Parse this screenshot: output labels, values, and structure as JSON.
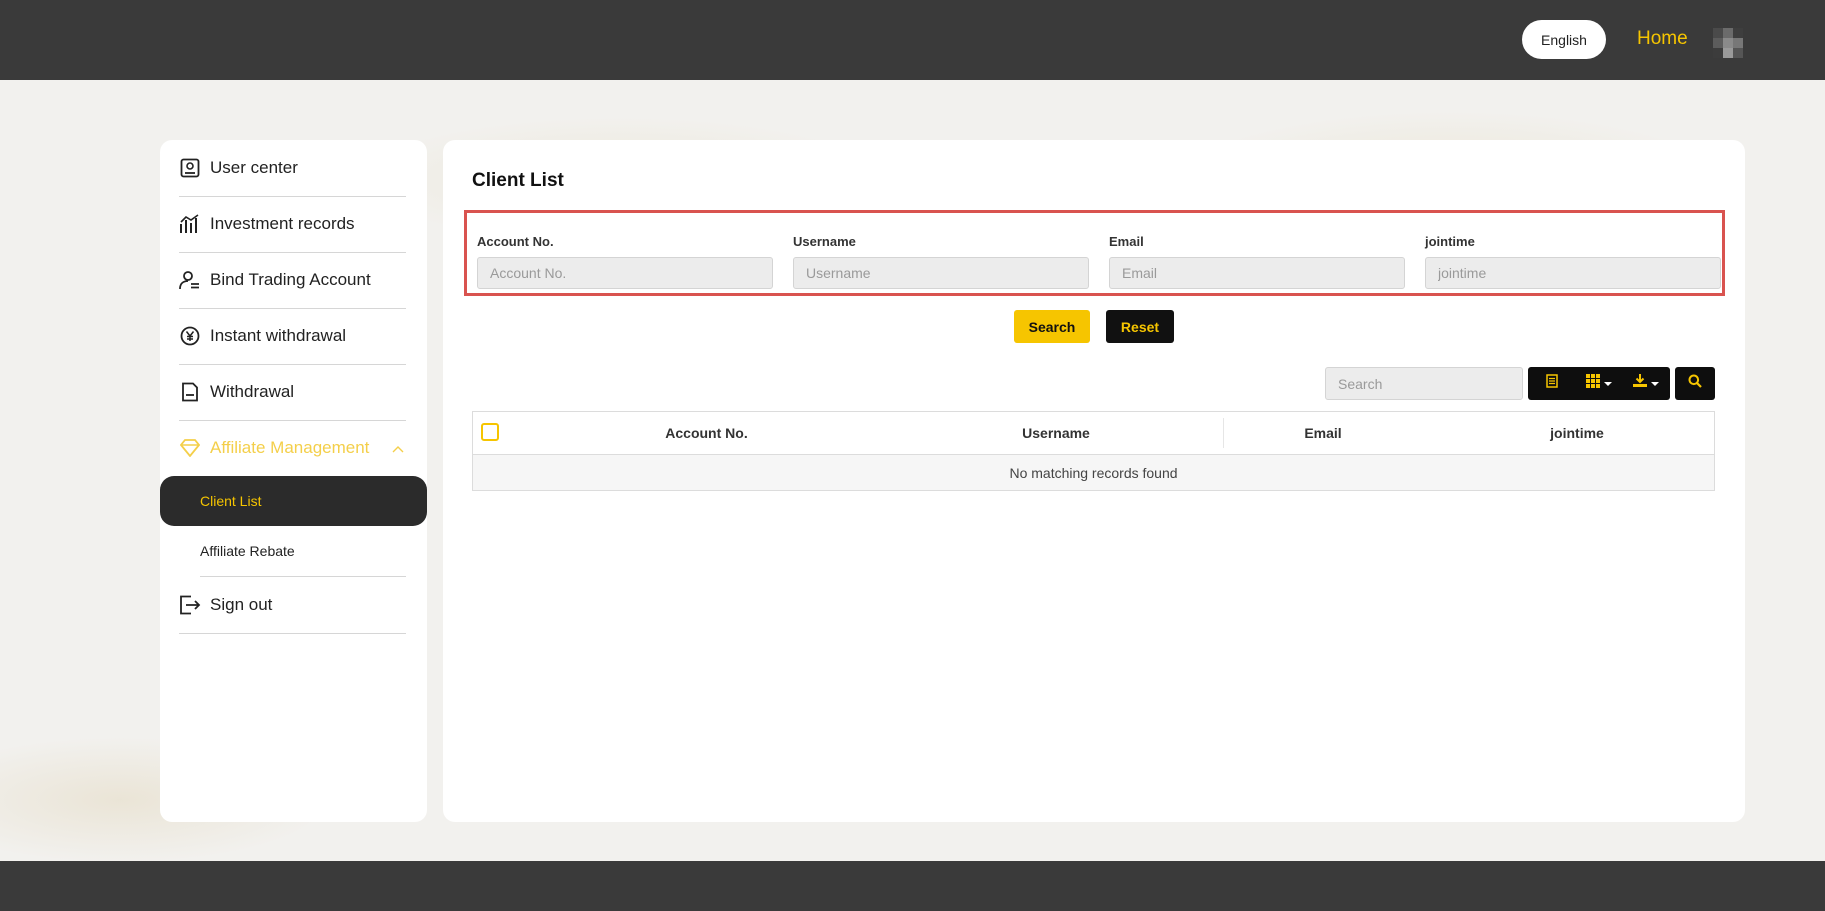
{
  "header": {
    "language_label": "English",
    "home_label": "Home"
  },
  "sidebar": {
    "items": [
      {
        "label": "User center",
        "icon": "user-card-icon"
      },
      {
        "label": "Investment records",
        "icon": "chart-icon"
      },
      {
        "label": "Bind Trading Account",
        "icon": "user-bind-icon"
      },
      {
        "label": "Instant withdrawal",
        "icon": "yen-coin-icon"
      },
      {
        "label": "Withdrawal",
        "icon": "document-icon"
      },
      {
        "label": "Affiliate Management",
        "icon": "diamond-icon"
      }
    ],
    "sub_items": [
      {
        "label": "Client List"
      },
      {
        "label": "Affiliate Rebate"
      }
    ],
    "sign_out_label": "Sign out"
  },
  "main": {
    "title": "Client List",
    "filters": [
      {
        "label": "Account No.",
        "placeholder": "Account No."
      },
      {
        "label": "Username",
        "placeholder": "Username"
      },
      {
        "label": "Email",
        "placeholder": "Email"
      },
      {
        "label": "jointime",
        "placeholder": "jointime"
      }
    ],
    "search_button": "Search",
    "reset_button": "Reset",
    "table_search_placeholder": "Search",
    "table": {
      "columns": [
        "Account No.",
        "Username",
        "Email",
        "jointime"
      ],
      "empty_message": "No matching records found"
    }
  },
  "colors": {
    "accent": "#f6c500",
    "header_bg": "#3a3a3a",
    "highlight_border": "#d9534f"
  }
}
